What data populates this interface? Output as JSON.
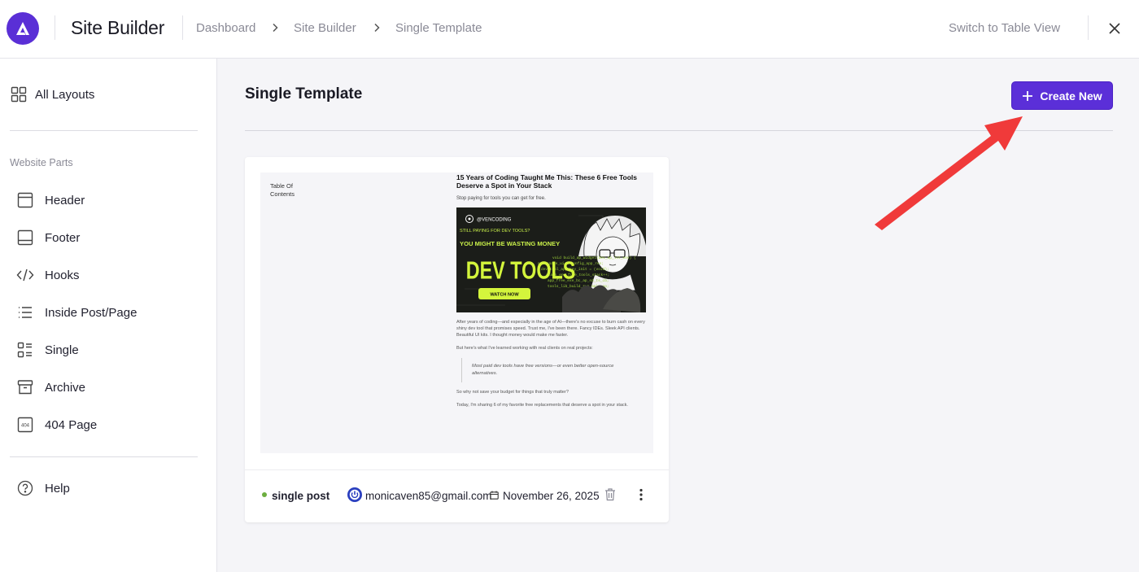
{
  "header": {
    "app_title": "Site Builder",
    "breadcrumb": [
      "Dashboard",
      "Site Builder",
      "Single Template"
    ],
    "switch_view": "Switch to Table View"
  },
  "sidebar": {
    "all_layouts": "All Layouts",
    "section_label": "Website Parts",
    "items": [
      {
        "label": "Header",
        "icon": "header-layout-icon"
      },
      {
        "label": "Footer",
        "icon": "footer-layout-icon"
      },
      {
        "label": "Hooks",
        "icon": "code-icon"
      },
      {
        "label": "Inside Post/Page",
        "icon": "list-icon"
      },
      {
        "label": "Single",
        "icon": "single-layout-icon"
      },
      {
        "label": "Archive",
        "icon": "archive-icon"
      },
      {
        "label": "404 Page",
        "icon": "404-icon"
      }
    ],
    "help": "Help"
  },
  "main": {
    "title": "Single Template",
    "create_button": "Create New",
    "accent_color": "#5b2fd8",
    "annotation_arrow_color": "#f03a3a"
  },
  "card": {
    "preview": {
      "toc": "Table Of Contents",
      "article_title": "15 Years of Coding Taught Me This: These 6 Free Tools Deserve a Spot in Your Stack",
      "subtitle": "Stop paying for tools you can get for free.",
      "banner": {
        "handle": "@VENCODING",
        "line1": "STILL PAYING FOR DEV TOOLS?",
        "line2": "YOU MIGHT BE WASTING MONEY",
        "headline": "DEV TOOLS",
        "cta": "WATCH NOW"
      },
      "para1": "After years of coding—and especially in the age of AI—there's no excuse to burn cash on every shiny dev tool that promises speed. Trust me, I've been there. Fancy IDEs. Sleek API clients. Beautiful UI kits. I thought money would make me faster.",
      "para2": "But here's what I've learned working with real clients on real projects:",
      "quote": "Most paid dev tools have free versions—or even better open-source alternatives.",
      "para3": "So why not save your budget for things that truly matter?",
      "para4": "Today, I'm sharing 6 of my favorite free replacements that deserve a spot in your stack."
    },
    "status": "single post",
    "status_color": "#6cae3f",
    "author": "monicaven85@gmail.com",
    "date": "November 26, 2025"
  }
}
